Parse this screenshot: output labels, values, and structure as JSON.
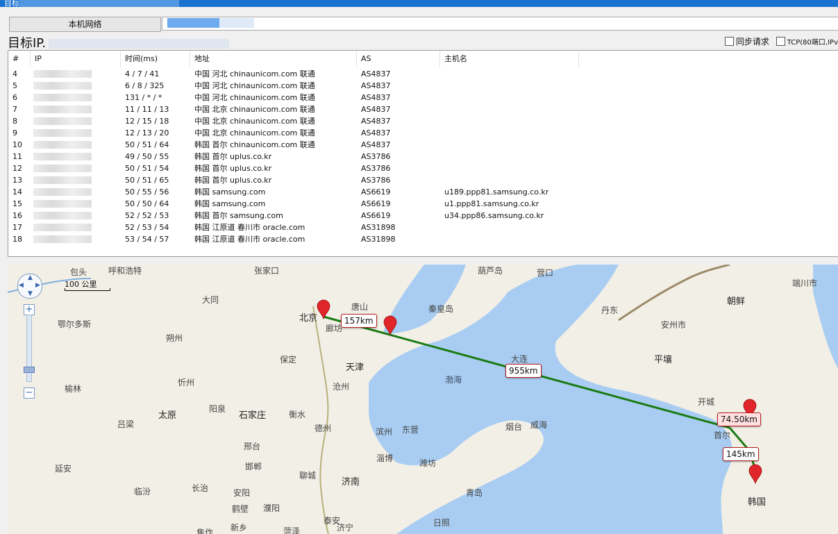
{
  "window": {
    "title": "目标"
  },
  "toolbar": {
    "local_network_label": "本机网络"
  },
  "target": {
    "label_prefix": "目标IP."
  },
  "options": {
    "sync_label": "同步请求",
    "tcp_label": "TCP(80端口,IPv"
  },
  "table": {
    "headers": [
      "#",
      "IP",
      "时间(ms)",
      "地址",
      "AS",
      "主机名"
    ],
    "rows": [
      {
        "n": "4",
        "time": "4 / 7 / 41",
        "addr": "中国 河北     chinaunicom.com 联通",
        "as": "AS4837",
        "host": ""
      },
      {
        "n": "5",
        "time": "6 / 8 / 325",
        "addr": "中国 河北     chinaunicom.com 联通",
        "as": "AS4837",
        "host": ""
      },
      {
        "n": "6",
        "time": "131 / * / *",
        "addr": "中国 河北     chinaunicom.com 联通",
        "as": "AS4837",
        "host": ""
      },
      {
        "n": "7",
        "time": "11 / 11 / 13",
        "addr": "中国 北京 chinaunicom.com 联通",
        "as": "AS4837",
        "host": ""
      },
      {
        "n": "8",
        "time": "12 / 15 / 18",
        "addr": "中国 北京 chinaunicom.com 联通",
        "as": "AS4837",
        "host": ""
      },
      {
        "n": "9",
        "time": "12 / 13 / 20",
        "addr": "中国 北京 chinaunicom.com 联通",
        "as": "AS4837",
        "host": ""
      },
      {
        "n": "10",
        "time": "50 / 51 / 64",
        "addr": "韩国 首尔 chinaunicom.com 联通",
        "as": "AS4837",
        "host": ""
      },
      {
        "n": "11",
        "time": "49 / 50 / 55",
        "addr": "韩国 首尔 uplus.co.kr",
        "as": "AS3786",
        "host": ""
      },
      {
        "n": "12",
        "time": "50 / 51 / 54",
        "addr": "韩国 首尔 uplus.co.kr",
        "as": "AS3786",
        "host": ""
      },
      {
        "n": "13",
        "time": "50 / 51 / 65",
        "addr": "韩国 首尔 uplus.co.kr",
        "as": "AS3786",
        "host": ""
      },
      {
        "n": "14",
        "time": "50 / 55 / 56",
        "addr": "韩国 samsung.com",
        "as": "AS6619",
        "host": "u189.ppp81.samsung.co.kr"
      },
      {
        "n": "15",
        "time": "50 / 50 / 64",
        "addr": "韩国 samsung.com",
        "as": "AS6619",
        "host": "u1.ppp81.samsung.co.kr"
      },
      {
        "n": "16",
        "time": "52 / 52 / 53",
        "addr": "韩国 首尔 samsung.com",
        "as": "AS6619",
        "host": "u34.ppp86.samsung.co.kr"
      },
      {
        "n": "17",
        "time": "52 / 53 / 54",
        "addr": "韩国 江原道 春川市 oracle.com",
        "as": "AS31898",
        "host": ""
      },
      {
        "n": "18",
        "time": "53 / 54 / 57",
        "addr": "韩国 江原道 春川市 oracle.com",
        "as": "AS31898",
        "host": ""
      }
    ]
  },
  "map": {
    "scale_label": "100 公里",
    "route_color": "#1a7a12",
    "marker_color": "#e0262b",
    "distances": [
      "157km",
      "955km",
      "74.50km",
      "145km"
    ],
    "places": [
      {
        "name": "包头",
        "cls": "gray"
      },
      {
        "name": "呼和浩特",
        "cls": "gray"
      },
      {
        "name": "张家口",
        "cls": "gray"
      },
      {
        "name": "大同",
        "cls": "gray"
      },
      {
        "name": "鄂尔多斯",
        "cls": "gray"
      },
      {
        "name": "朔州",
        "cls": "gray"
      },
      {
        "name": "忻州",
        "cls": "gray"
      },
      {
        "name": "榆林",
        "cls": "gray"
      },
      {
        "name": "太原",
        "cls": "big"
      },
      {
        "name": "阳泉",
        "cls": "gray"
      },
      {
        "name": "石家庄",
        "cls": "big"
      },
      {
        "name": "吕梁",
        "cls": "gray"
      },
      {
        "name": "北京",
        "cls": "big"
      },
      {
        "name": "保定",
        "cls": "gray"
      },
      {
        "name": "廊坊",
        "cls": "gray"
      },
      {
        "name": "天津",
        "cls": "big"
      },
      {
        "name": "沧州",
        "cls": "gray"
      },
      {
        "name": "衡水",
        "cls": "gray"
      },
      {
        "name": "德州",
        "cls": "gray"
      },
      {
        "name": "邢台",
        "cls": "gray"
      },
      {
        "name": "邯郸",
        "cls": "gray"
      },
      {
        "name": "长治",
        "cls": "gray"
      },
      {
        "name": "临汾",
        "cls": "gray"
      },
      {
        "name": "延安",
        "cls": "gray"
      },
      {
        "name": "聊城",
        "cls": "gray"
      },
      {
        "name": "济南",
        "cls": "big"
      },
      {
        "name": "滨州",
        "cls": "gray"
      },
      {
        "name": "东营",
        "cls": "gray"
      },
      {
        "name": "淄博",
        "cls": "gray"
      },
      {
        "name": "潍坊",
        "cls": "gray"
      },
      {
        "name": "安阳",
        "cls": "gray"
      },
      {
        "name": "鹤壁",
        "cls": "gray"
      },
      {
        "name": "濮阳",
        "cls": "gray"
      },
      {
        "name": "新乡",
        "cls": "gray"
      },
      {
        "name": "焦作",
        "cls": "gray"
      },
      {
        "name": "菏泽",
        "cls": "gray"
      },
      {
        "name": "济宁",
        "cls": "gray"
      },
      {
        "name": "泰安",
        "cls": "gray"
      },
      {
        "name": "青岛",
        "cls": "gray"
      },
      {
        "name": "日照",
        "cls": "gray"
      },
      {
        "name": "烟台",
        "cls": "gray"
      },
      {
        "name": "威海",
        "cls": "gray"
      },
      {
        "name": "渤海",
        "cls": "sea"
      },
      {
        "name": "大连",
        "cls": "gray"
      },
      {
        "name": "秦皇岛",
        "cls": "gray"
      },
      {
        "name": "唐山",
        "cls": "gray"
      },
      {
        "name": "葫芦岛",
        "cls": "gray"
      },
      {
        "name": "营口",
        "cls": "gray"
      },
      {
        "name": "丹东",
        "cls": "gray"
      },
      {
        "name": "安州市",
        "cls": "gray"
      },
      {
        "name": "平壤",
        "cls": "big"
      },
      {
        "name": "朝鲜",
        "cls": "big"
      },
      {
        "name": "端川市",
        "cls": "gray"
      },
      {
        "name": "开城",
        "cls": "gray"
      },
      {
        "name": "首尔",
        "cls": "gray"
      },
      {
        "name": "韩国",
        "cls": "big"
      }
    ]
  }
}
